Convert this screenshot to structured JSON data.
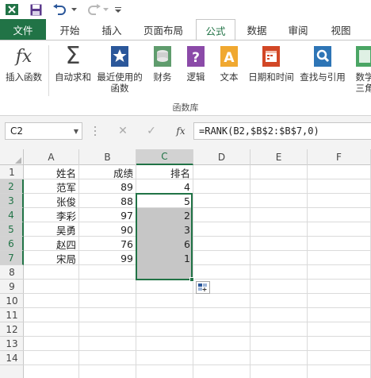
{
  "quick_access": {
    "icons": [
      "excel-app-icon",
      "save-icon",
      "undo-icon",
      "redo-icon",
      "customize-qat-icon"
    ]
  },
  "tabs": [
    {
      "label": "文件",
      "active": false
    },
    {
      "label": "开始",
      "active": false
    },
    {
      "label": "插入",
      "active": false
    },
    {
      "label": "页面布局",
      "active": false
    },
    {
      "label": "公式",
      "active": true
    },
    {
      "label": "数据",
      "active": false
    },
    {
      "label": "审阅",
      "active": false
    },
    {
      "label": "视图",
      "active": false
    }
  ],
  "ribbon": {
    "buttons": [
      {
        "line1": "插入函数",
        "line2": ""
      },
      {
        "line1": "自动求和",
        "line2": ""
      },
      {
        "line1": "最近使用的",
        "line2": "函数"
      },
      {
        "line1": "财务",
        "line2": ""
      },
      {
        "line1": "逻辑",
        "line2": ""
      },
      {
        "line1": "文本",
        "line2": ""
      },
      {
        "line1": "日期和时间",
        "line2": ""
      },
      {
        "line1": "查找与引用",
        "line2": ""
      },
      {
        "line1": "数学",
        "line2": "三角"
      }
    ],
    "group_label": "函数库"
  },
  "formula_bar": {
    "name_box": "C2",
    "fx_label": "fx",
    "formula": "=RANK(B2,$B$2:$B$7,0)"
  },
  "grid": {
    "columns": [
      "A",
      "B",
      "C",
      "D",
      "E",
      "F"
    ],
    "selected_column": "C",
    "rows": [
      "1",
      "2",
      "3",
      "4",
      "5",
      "6",
      "7",
      "8",
      "9",
      "10",
      "11",
      "12",
      "13",
      "14"
    ],
    "selected_rows": [
      "2",
      "3",
      "4",
      "5",
      "6",
      "7"
    ],
    "cells": {
      "A": [
        "姓名",
        "范军",
        "张俊",
        "李彩",
        "吴勇",
        "赵四",
        "宋局"
      ],
      "B": [
        "成绩",
        "89",
        "88",
        "97",
        "90",
        "76",
        "99"
      ],
      "C": [
        "排名",
        "4",
        "5",
        "2",
        "3",
        "6",
        "1"
      ]
    }
  },
  "colors": {
    "accent": "#217346",
    "selection_fill": "#c6c6c6"
  }
}
